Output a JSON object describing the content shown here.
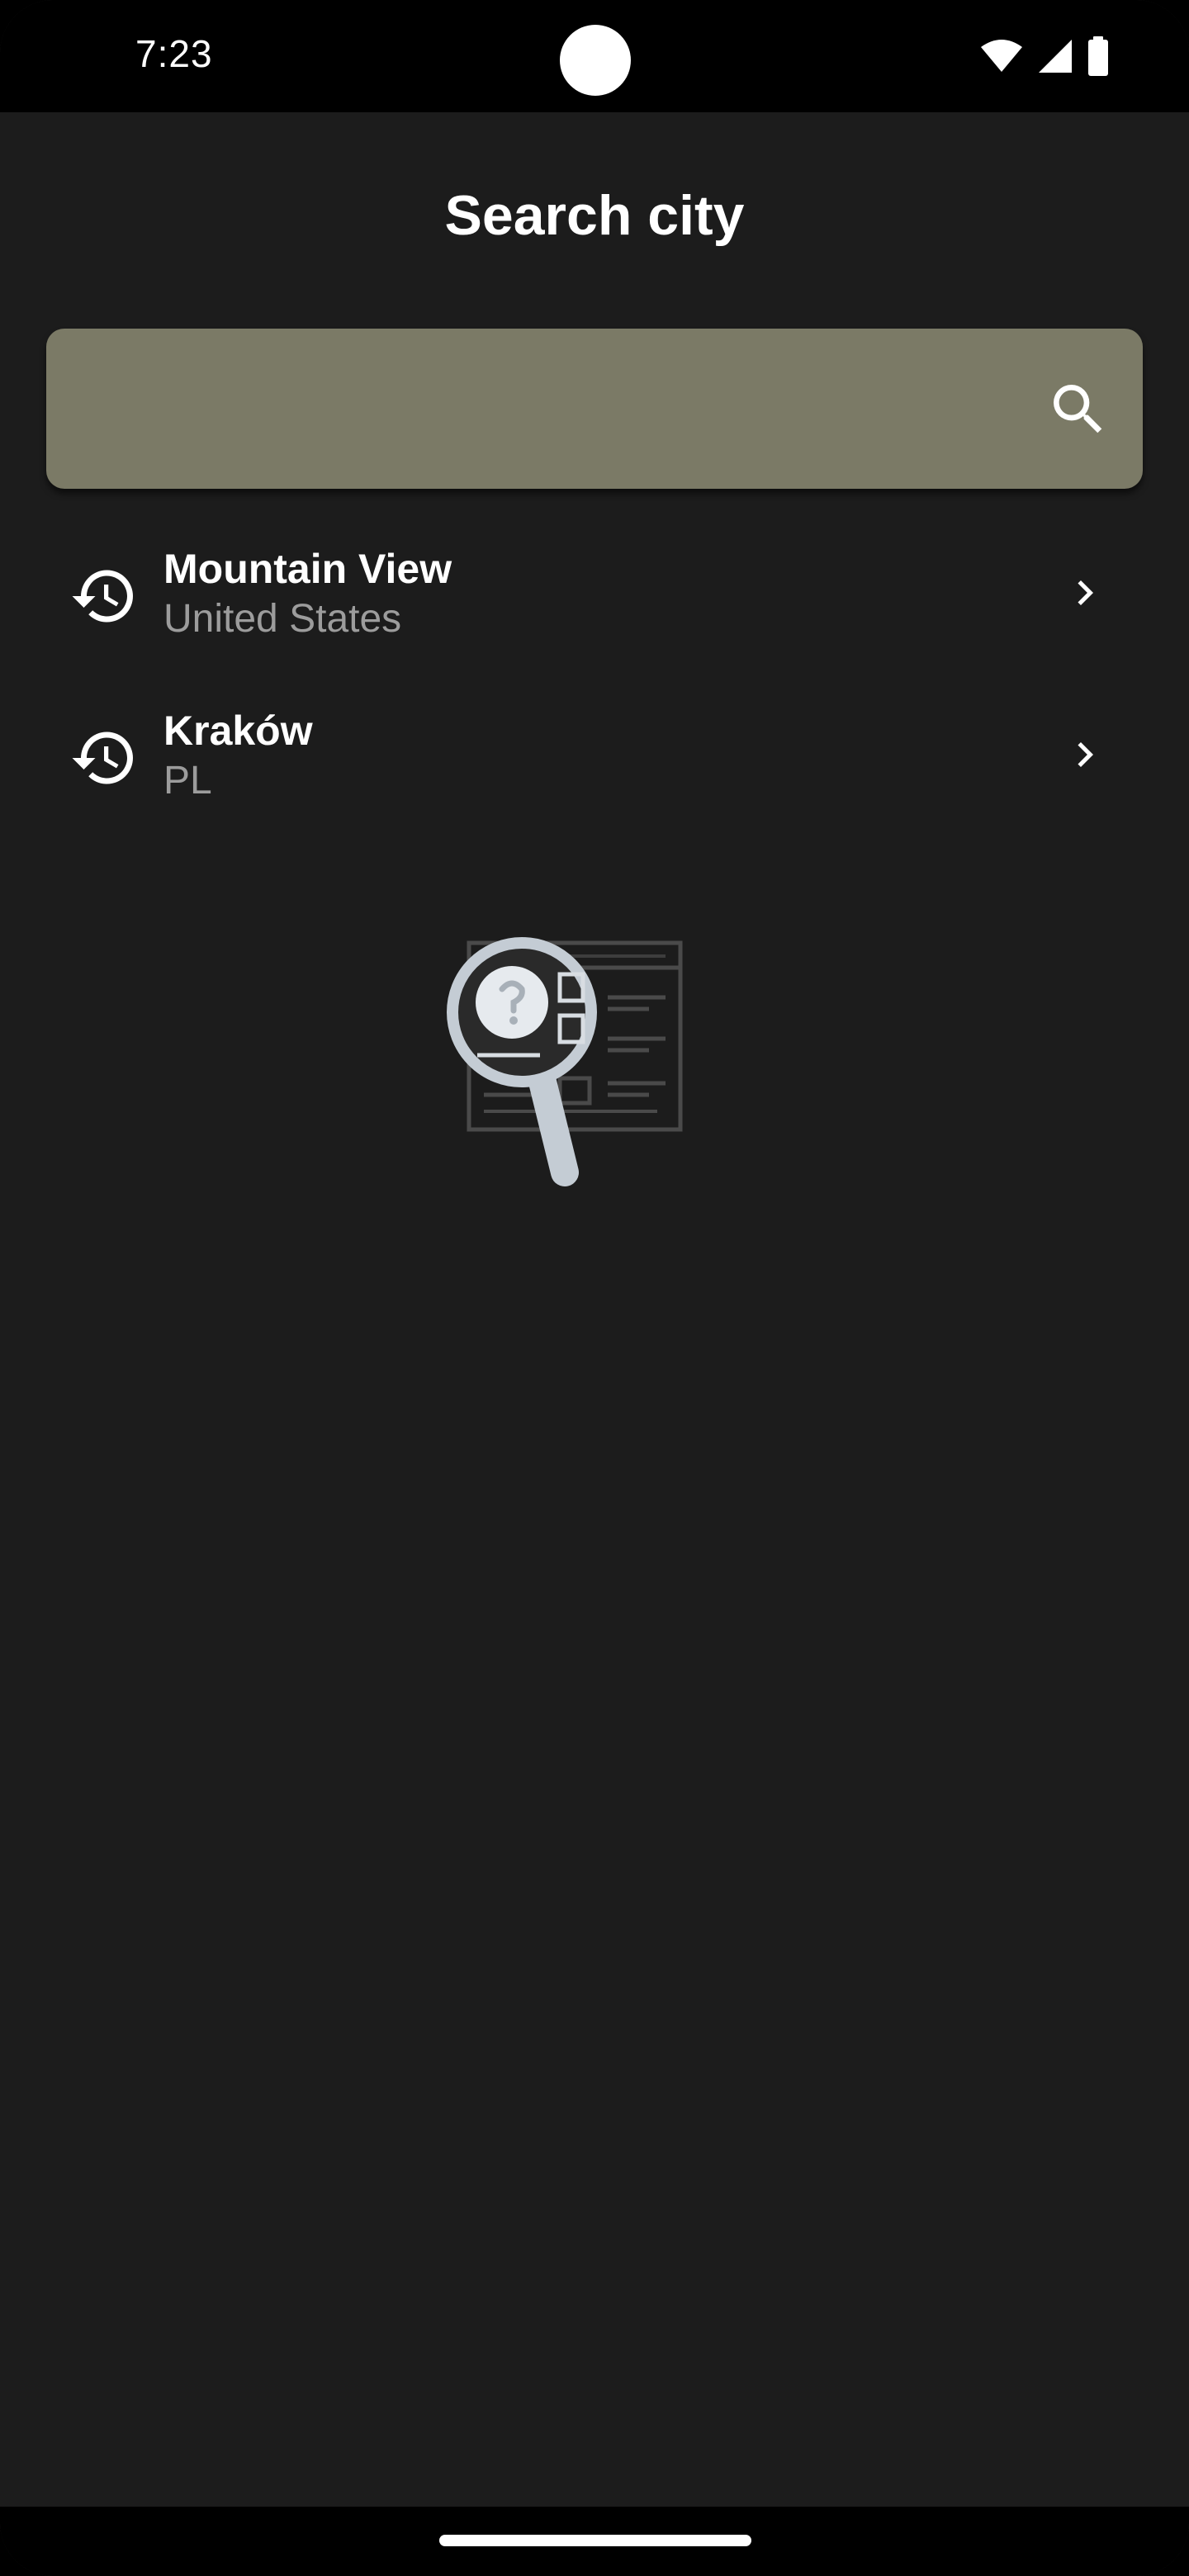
{
  "status_bar": {
    "time": "7:23",
    "icons": [
      "wifi-icon",
      "cellular-signal-icon",
      "battery-icon"
    ]
  },
  "header": {
    "title": "Search city"
  },
  "search": {
    "value": "",
    "placeholder": "",
    "icon": "search-icon",
    "background_color": "#7b7a66"
  },
  "history": {
    "items": [
      {
        "title": "Mountain View",
        "subtitle": "United States",
        "icon": "history-icon",
        "action_icon": "chevron-right-icon"
      },
      {
        "title": "Kraków",
        "subtitle": "PL",
        "icon": "history-icon",
        "action_icon": "chevron-right-icon"
      }
    ]
  },
  "empty_state": {
    "icon": "magnifier-document-illustration"
  },
  "colors": {
    "background": "#1c1c1c",
    "text_primary": "#ffffff",
    "text_secondary": "#9c9c9c",
    "search_field": "#7b7a66"
  }
}
